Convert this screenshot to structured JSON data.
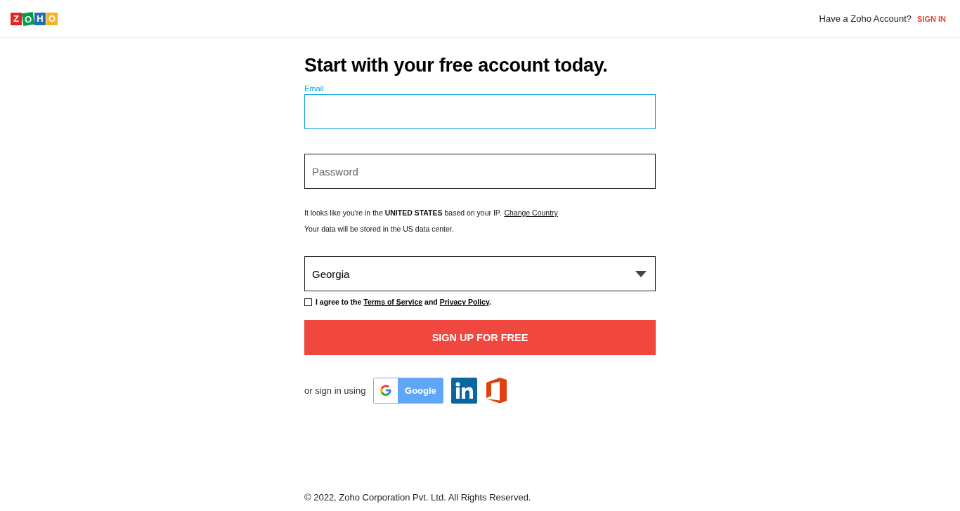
{
  "header": {
    "logo": [
      {
        "letter": "Z",
        "color": "#e42527"
      },
      {
        "letter": "O",
        "color": "#089949"
      },
      {
        "letter": "H",
        "color": "#226db4"
      },
      {
        "letter": "O",
        "color": "#f9b21d"
      }
    ],
    "prompt": "Have a Zoho Account?",
    "sign_in": "SIGN IN"
  },
  "form": {
    "title": "Start with your free account today.",
    "email": {
      "label": "Email",
      "focused": true
    },
    "password": {
      "placeholder": "Password"
    },
    "location_notice": "It looks like you're in the **UNITED STATES** based on your IP.",
    "change_country": "Change Country",
    "data_notice": "Your data will be stored in the US data center.",
    "country": {
      "value": "Georgia"
    },
    "agreement": {
      "checked": false,
      "before": "I agree to the",
      "terms": "Terms of Service",
      "middle": "and",
      "privacy": "Privacy Policy",
      "after": "."
    },
    "submit": "SIGN UP FOR FREE",
    "social": {
      "label": "or sign in using",
      "google": "Google"
    }
  },
  "footer": "© 2022, Zoho Corporation Pvt. Ltd. All Rights Reserved."
}
